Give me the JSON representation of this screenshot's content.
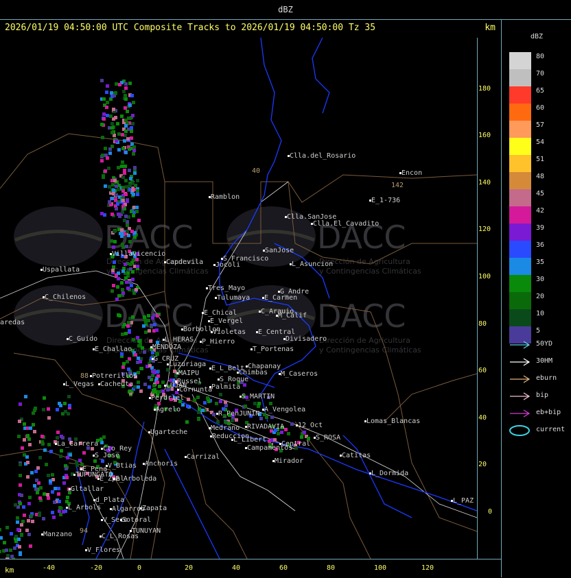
{
  "header": {
    "product": "dBZ"
  },
  "titlebar": {
    "title": "2026/01/19 04:50:00 UTC Composite Tracks to 2026/01/19 04:50:00 Tz 35",
    "unit": "km"
  },
  "legend": {
    "title": "dBZ",
    "scale": [
      {
        "value": "80",
        "color": "#d4d4d4"
      },
      {
        "value": "70",
        "color": "#bfbfbf"
      },
      {
        "value": "65",
        "color": "#ff3a2a"
      },
      {
        "value": "60",
        "color": "#ff6a10"
      },
      {
        "value": "57",
        "color": "#ff9a5a"
      },
      {
        "value": "54",
        "color": "#ffff1a"
      },
      {
        "value": "51",
        "color": "#ffc22a"
      },
      {
        "value": "48",
        "color": "#d58a3a"
      },
      {
        "value": "45",
        "color": "#c46a8a"
      },
      {
        "value": "42",
        "color": "#d41a9a"
      },
      {
        "value": "39",
        "color": "#7a1ad4"
      },
      {
        "value": "36",
        "color": "#2a4aff"
      },
      {
        "value": "35",
        "color": "#1a8ae4"
      },
      {
        "value": "30",
        "color": "#0a8a0a"
      },
      {
        "value": "20",
        "color": "#0a6a0a"
      },
      {
        "value": "10",
        "color": "#0a4a1a"
      },
      {
        "value": "5",
        "color": "#4a3a9a"
      }
    ],
    "tracks": [
      {
        "label": "50YD",
        "color": "#5ad4e4",
        "type": "arrow"
      },
      {
        "label": "30HM",
        "color": "#ffffff",
        "type": "arrow"
      },
      {
        "label": "eburn",
        "color": "#e4b47a",
        "type": "arrow"
      },
      {
        "label": "bip",
        "color": "#f4c4d4",
        "type": "arrow"
      },
      {
        "label": "eb+bip",
        "color": "#d43ad4",
        "type": "arrow"
      },
      {
        "label": "current",
        "color": "#3ad4e4",
        "type": "ellipse"
      }
    ]
  },
  "axes": {
    "unit": "km",
    "y_ticks": [
      "180",
      "160",
      "140",
      "120",
      "100",
      "80",
      "60",
      "40",
      "20",
      "0"
    ],
    "x_ticks": [
      "-40",
      "-20",
      "0",
      "20",
      "40",
      "60",
      "80",
      "100",
      "120"
    ]
  },
  "watermark": {
    "brand": "DACC",
    "line1": "Dirección de Agricultura",
    "line2": "y Contingencias Climáticas"
  },
  "places": [
    "Clla.del_Rosario",
    "Encon",
    "142",
    "E_1-736",
    "Ramblon",
    "40",
    "Clla.SanJose",
    "Clla.El_Cavadito",
    "S_Francisco",
    "SanJose",
    "Villavicencio",
    "Capdevila",
    "L_Asuncion",
    "Uspallata",
    "Jocoli",
    "Tres_Mayo",
    "Tulumaya",
    "G_Andre",
    "E_Carmen",
    "C_Chilenos",
    "E_Chical",
    "C_Arauio",
    "M_Calif",
    "aredas",
    "E_Vergel",
    "Borbollon",
    "Violetas",
    "E_Central",
    "Divisadero",
    "C_Guido",
    "L_HERAS",
    "P_Hierro",
    "E_Challao",
    "MENDOZA",
    "T_Portenas",
    "G_CRUZ",
    "Luzuriaga",
    "E_L_Belt",
    "Chapanay",
    "88",
    "Potrerillos",
    "MAIPU",
    "Russel",
    "Chimbas",
    "M_Caseros",
    "L_Vegas",
    "Cacheuta",
    "LUJAN",
    "Cornunta",
    "Palmita",
    "S_Roque",
    "S_MARTIN",
    "Perdriel",
    "A_Vengolea",
    "Agrelo",
    "R_PenJUNIN",
    "Ugarteche",
    "Medrano",
    "RIVADAVIA",
    "12_Oct",
    "Lomas_Blancas",
    "Reduccion",
    "L_Libert",
    "S_ROSA",
    "La_Carrera",
    "Cto_Rey",
    "Central",
    "S_Jose",
    "Carrizal",
    "Campamentos",
    "Catitas",
    "E_Pena",
    "V_Btias",
    "Anchoris",
    "Mirador",
    "TUPUNGATO",
    "E_Arboleda",
    "L_Dormida",
    "Gltallar",
    "E_Zpal",
    "d_Plata",
    "L_Arbols",
    "Zapata",
    "L_PAZ",
    "V_Seco",
    "Algarrob",
    "Sotoral",
    "TUNUYAN",
    "Manzano",
    "94",
    "C_L_Rosas",
    "V_Flores"
  ]
}
